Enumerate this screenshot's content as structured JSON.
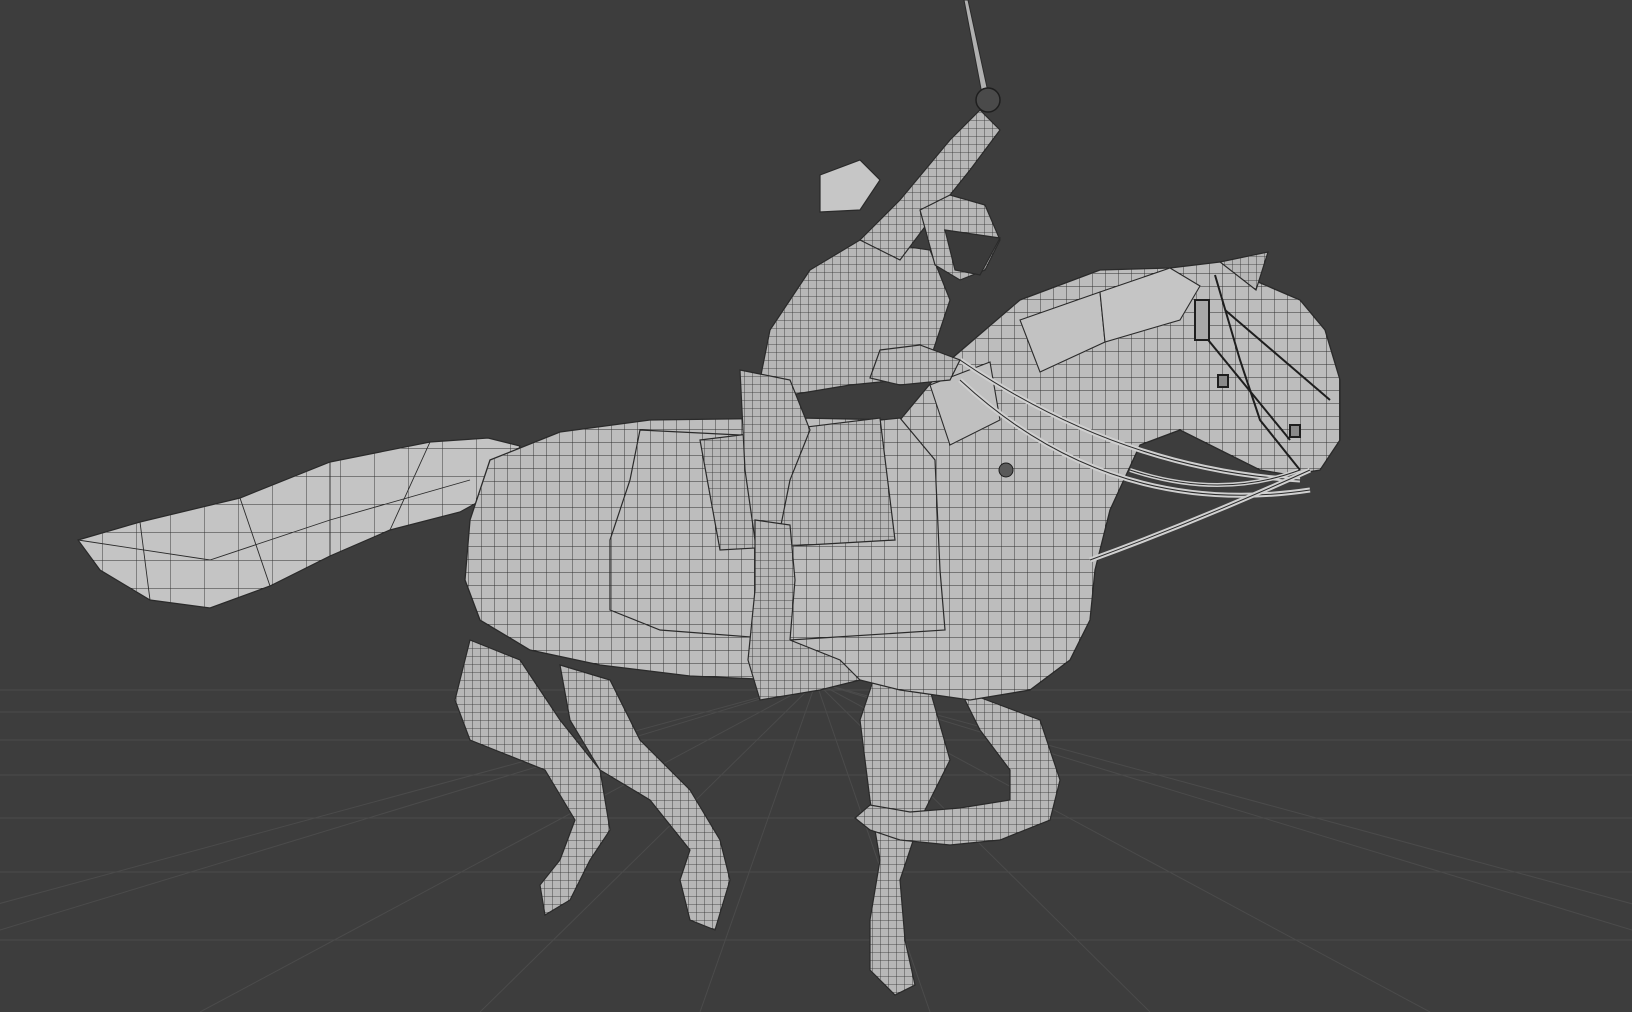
{
  "viewport": {
    "mode": "3d-viewport",
    "shading": "solid-wireframe-overlay",
    "background_color": "#3d3d3d",
    "grid_line_color": "#4b4b4b",
    "mesh_fill_color": "#b9b9b9",
    "mesh_wire_color": "#2b2b2b"
  },
  "scene": {
    "objects": [
      {
        "name": "horse",
        "icon": "horse-mesh"
      },
      {
        "name": "rider",
        "icon": "rider-mesh"
      },
      {
        "name": "saber",
        "icon": "saber-mesh"
      },
      {
        "name": "reins",
        "icon": "reins-mesh"
      },
      {
        "name": "saddle-blanket",
        "icon": "saddle-mesh"
      }
    ]
  }
}
